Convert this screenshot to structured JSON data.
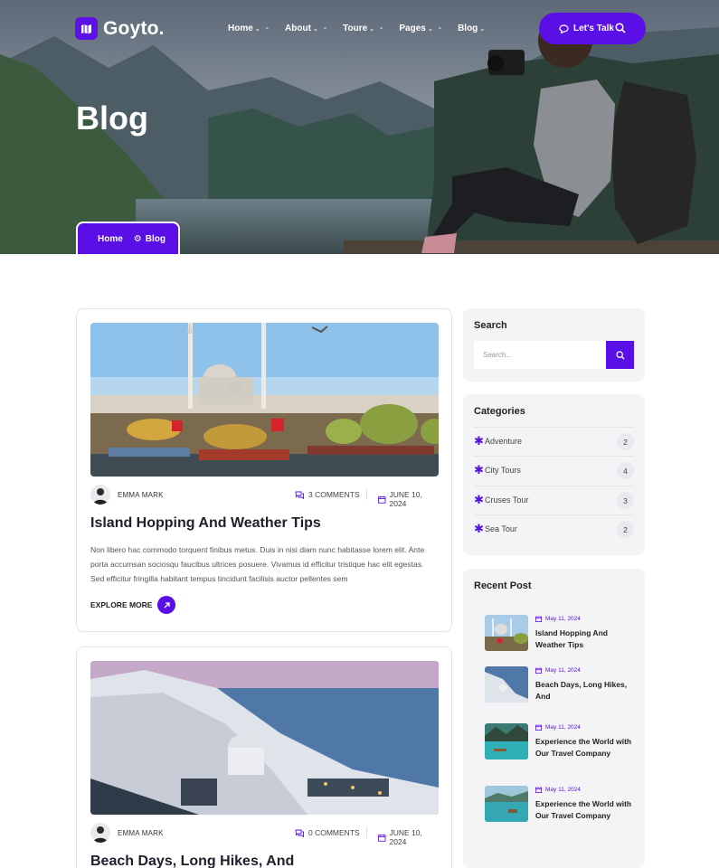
{
  "brand": {
    "name": "Goyto.",
    "accent": "#5a0fe6"
  },
  "nav": {
    "items": [
      {
        "label": "Home"
      },
      {
        "label": "About"
      },
      {
        "label": "Toure"
      },
      {
        "label": "Pages"
      },
      {
        "label": "Blog"
      }
    ],
    "cta_label": "Let's Talk"
  },
  "hero": {
    "title": "Blog",
    "breadcrumb": {
      "home": "Home",
      "current": "Blog"
    }
  },
  "posts": [
    {
      "author": "EMMA MARK",
      "comments": "3 COMMENTS",
      "date": "JUNE 10, 2024",
      "title": "Island Hopping And Weather Tips",
      "excerpt": "Non libero hac commodo torquent finibus metus. Duis in nisi diam nunc habitasse lorem elit. Ante porta accumsan sociosqu faucibus ultrices posuere. Vivamus id efficitur tristique hac elit egestas. Sed efficitur fringilla habitant tempus tincidunt facilisis auctor pellentes sem",
      "cta": "EXPLORE MORE"
    },
    {
      "author": "EMMA MARK",
      "comments": "0 COMMENTS",
      "date": "JUNE 10, 2024",
      "title": "Beach Days, Long Hikes, And"
    }
  ],
  "sidebar": {
    "search": {
      "title": "Search",
      "placeholder": "Search..."
    },
    "categories": {
      "title": "Categories",
      "items": [
        {
          "label": "Adventure",
          "count": "2"
        },
        {
          "label": "City Tours",
          "count": "4"
        },
        {
          "label": "Cruses Tour",
          "count": "3"
        },
        {
          "label": "Sea Tour",
          "count": "2"
        }
      ]
    },
    "recent": {
      "title": "Recent Post",
      "items": [
        {
          "date": "May 11, 2024",
          "title": "Island Hopping And Weather Tips"
        },
        {
          "date": "May 11, 2024",
          "title": "Beach Days, Long Hikes, And"
        },
        {
          "date": "May 11, 2024",
          "title": "Experience the World with Our Travel Company"
        },
        {
          "date": "May 11, 2024",
          "title": "Experience the World with Our Travel Company"
        }
      ]
    }
  }
}
